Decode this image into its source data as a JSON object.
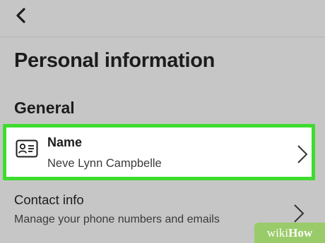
{
  "header": {
    "back_icon": "chevron-left-icon"
  },
  "page": {
    "title": "Personal information",
    "section": "General"
  },
  "name_item": {
    "icon": "id-card-icon",
    "label": "Name",
    "value": "Neve Lynn Campbelle",
    "highlight_color": "#3ddc2e"
  },
  "contact_item": {
    "label": "Contact info",
    "description": "Manage your phone numbers and emails"
  },
  "watermark": {
    "part1": "wiki",
    "part2": "How"
  },
  "colors": {
    "background": "#c6c6c6",
    "card": "#ffffff",
    "text": "#1c1c1c"
  }
}
